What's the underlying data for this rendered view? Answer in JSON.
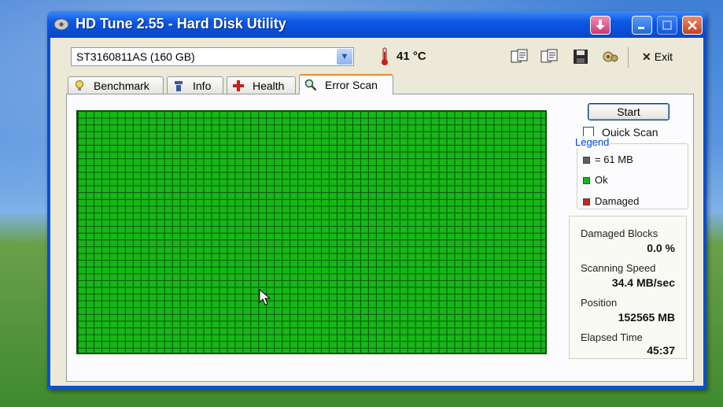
{
  "window": {
    "title": "HD Tune 2.55 - Hard Disk Utility",
    "buttons": {
      "minimize": "_",
      "close": "✕",
      "download": "↓"
    }
  },
  "toolbar": {
    "drive": "ST3160811AS (160 GB)",
    "temperature": "41 °C",
    "exit_label": "Exit",
    "icons": [
      "copy-text-icon",
      "copy-info-icon",
      "save-icon",
      "options-icon"
    ]
  },
  "tabs": [
    {
      "label": "Benchmark",
      "icon": "lightbulb-icon"
    },
    {
      "label": "Info",
      "icon": "info-icon"
    },
    {
      "label": "Health",
      "icon": "health-cross-icon"
    },
    {
      "label": "Error Scan",
      "icon": "magnifier-icon",
      "active": true
    }
  ],
  "scan": {
    "start_label": "Start",
    "quick_scan_label": "Quick Scan",
    "quick_scan_checked": false,
    "block_color": "#16b816"
  },
  "legend": {
    "title": "Legend",
    "items": [
      {
        "label": "= 61 MB",
        "color": "#606060"
      },
      {
        "label": "Ok",
        "color": "#16b816"
      },
      {
        "label": "Damaged",
        "color": "#d02020"
      }
    ]
  },
  "stats": {
    "damaged_blocks_label": "Damaged Blocks",
    "damaged_blocks_value": "0.0 %",
    "scanning_speed_label": "Scanning Speed",
    "scanning_speed_value": "34.4 MB/sec",
    "position_label": "Position",
    "position_value": "152565 MB",
    "elapsed_label": "Elapsed Time",
    "elapsed_value": "45:37"
  }
}
